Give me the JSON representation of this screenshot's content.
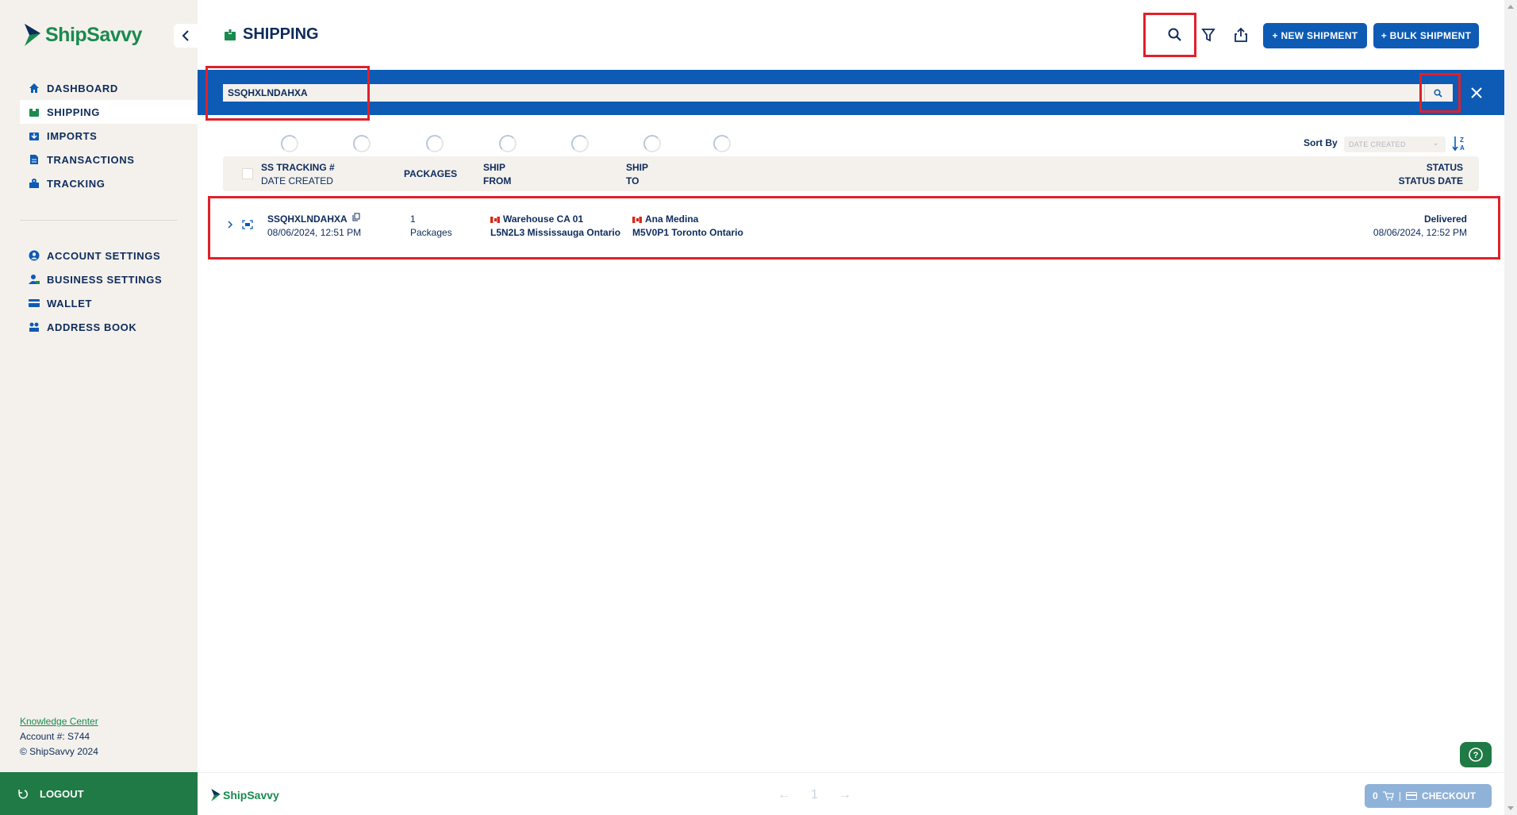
{
  "app": {
    "name": "ShipSavvy"
  },
  "sidebar": {
    "items": [
      {
        "label": "DASHBOARD",
        "icon": "home-icon"
      },
      {
        "label": "SHIPPING",
        "icon": "package-icon",
        "active": true
      },
      {
        "label": "IMPORTS",
        "icon": "import-icon"
      },
      {
        "label": "TRANSACTIONS",
        "icon": "document-icon"
      },
      {
        "label": "TRACKING",
        "icon": "tracking-icon"
      }
    ],
    "settings_items": [
      {
        "label": "ACCOUNT SETTINGS",
        "icon": "user-circle-icon"
      },
      {
        "label": "BUSINESS SETTINGS",
        "icon": "business-user-icon"
      },
      {
        "label": "WALLET",
        "icon": "wallet-icon"
      },
      {
        "label": "ADDRESS BOOK",
        "icon": "address-book-icon"
      }
    ],
    "knowledge_center": "Knowledge Center",
    "account": "Account #: S744",
    "copyright": "© ShipSavvy 2024",
    "logout": "LOGOUT"
  },
  "header": {
    "title": "SHIPPING",
    "new_shipment": "+ NEW SHIPMENT",
    "bulk_shipment": "+ BULK SHIPMENT"
  },
  "search": {
    "value": "SSQHXLNDAHXA"
  },
  "sort": {
    "label": "Sort By",
    "selected": "DATE CREATED"
  },
  "table": {
    "headers": {
      "tracking": "SS TRACKING #",
      "date_created": "DATE CREATED",
      "packages": "PACKAGES",
      "ship_from_1": "SHIP",
      "ship_from_2": "FROM",
      "ship_to_1": "SHIP",
      "ship_to_2": "TO",
      "status": "STATUS",
      "status_date": "STATUS DATE"
    },
    "rows": [
      {
        "tracking": "SSQHXLNDAHXA",
        "date_created": "08/06/2024, 12:51 PM",
        "packages_count": "1",
        "packages_label": "Packages",
        "from_name": "Warehouse CA 01",
        "from_address": "L5N2L3 Mississauga Ontario",
        "to_name": "Ana Medina",
        "to_address": "M5V0P1 Toronto Ontario",
        "status": "Delivered",
        "status_date": "08/06/2024, 12:52 PM"
      }
    ]
  },
  "pagination": {
    "page": "1"
  },
  "cart": {
    "count": "0",
    "checkout": "CHECKOUT"
  },
  "colors": {
    "primary": "#0d5bb5",
    "brand_green": "#1f7a45",
    "highlight": "#e0202a",
    "sidebar_bg": "#f4f1ec"
  }
}
